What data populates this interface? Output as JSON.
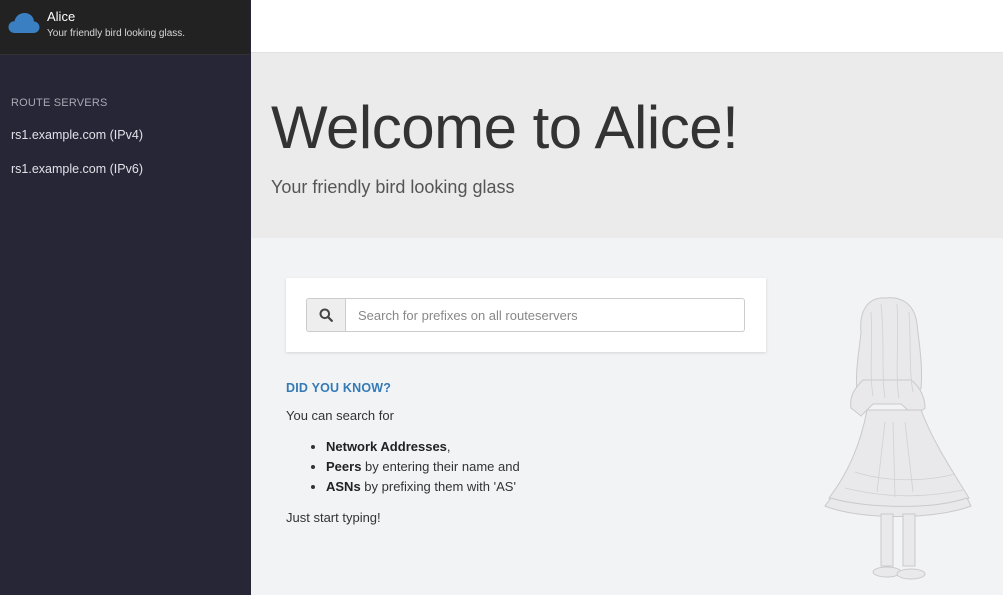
{
  "brand": {
    "title": "Alice",
    "subtitle": "Your friendly bird looking glass.",
    "logo_color": "#3a7fc2"
  },
  "sidebar": {
    "section_label": "ROUTE SERVERS",
    "items": [
      {
        "label": "rs1.example.com (IPv4)"
      },
      {
        "label": "rs1.example.com (IPv6)"
      }
    ]
  },
  "jumbotron": {
    "heading": "Welcome to Alice!",
    "lead": "Your friendly bird looking glass"
  },
  "search": {
    "placeholder": "Search for prefixes on all routeservers",
    "icon": "search-icon"
  },
  "did_you_know": {
    "title": "DID YOU KNOW?",
    "intro": "You can search for",
    "items": [
      {
        "strong": "Network Addresses",
        "rest": ","
      },
      {
        "strong": "Peers",
        "rest": " by entering their name and"
      },
      {
        "strong": "ASNs",
        "rest": " by prefixing them with 'AS'"
      }
    ],
    "outro": "Just start typing!"
  },
  "colors": {
    "sidebar_bg": "#262637",
    "brand_bg": "#222222",
    "accent": "#337ab7",
    "jumbotron_bg": "#ebebeb"
  }
}
